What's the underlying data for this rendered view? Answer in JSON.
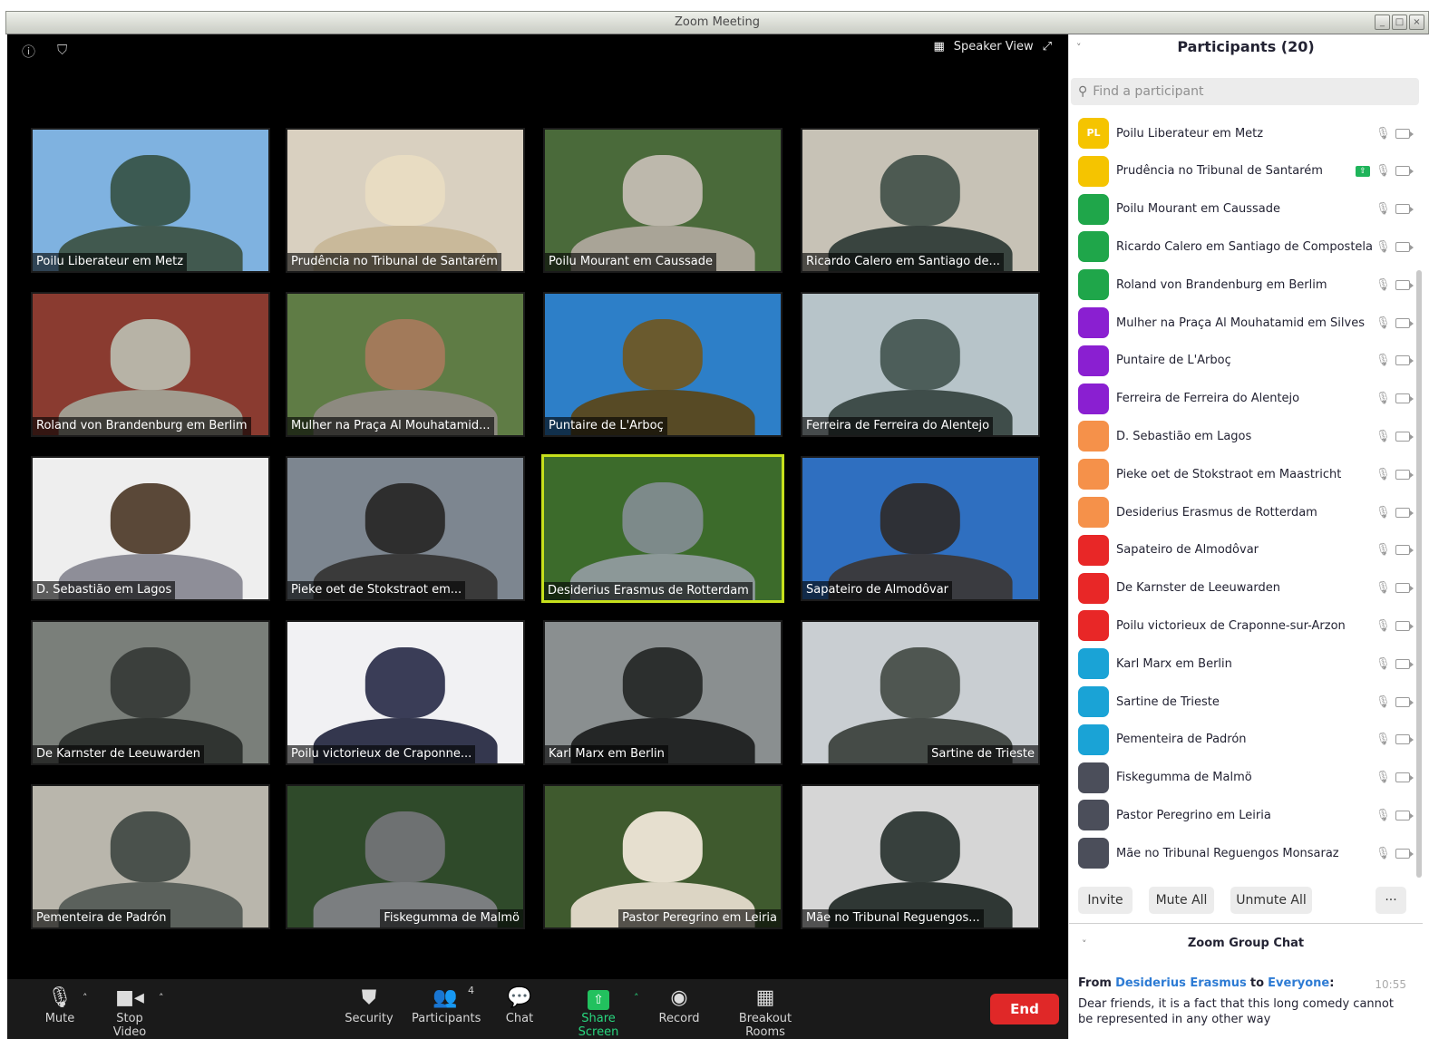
{
  "window": {
    "title": "Zoom Meeting",
    "controls": [
      "_",
      "□",
      "×"
    ]
  },
  "meeting": {
    "speaker_view_label": "Speaker View"
  },
  "tiles": [
    {
      "name": "Poilu Liberateur em Metz",
      "bg": "#7fb2e0",
      "head": "#3c5a52",
      "body": "#41594f"
    },
    {
      "name": "Prudência no Tribunal de Santarém",
      "bg": "#d9d0c0",
      "head": "#e8dcc2",
      "body": "#c9b99a"
    },
    {
      "name": "Poilu Mourant em Caussade",
      "bg": "#4a6a3a",
      "head": "#bdb8ac",
      "body": "#a9a497"
    },
    {
      "name": "Ricardo Calero em Santiago de...",
      "bg": "#c7c2b6",
      "head": "#4d5a52",
      "body": "#39443f"
    },
    {
      "name": "Roland von Brandenburg em Berlim",
      "bg": "#8a3b30",
      "head": "#b7b3a6",
      "body": "#a19d90"
    },
    {
      "name": "Mulher na Praça Al Mouhatamid...",
      "bg": "#5f7c45",
      "head": "#a27a5a",
      "body": "#8d8a80"
    },
    {
      "name": "Puntaire de L'Arboç",
      "bg": "#2d7fc8",
      "head": "#6a5a2e",
      "body": "#574a25"
    },
    {
      "name": "Ferreira de Ferreira do Alentejo",
      "bg": "#b7c4c9",
      "head": "#4d5e5a",
      "body": "#3f4d4a"
    },
    {
      "name": "D. Sebastião em Lagos",
      "bg": "#eeeeee",
      "head": "#5a4838",
      "body": "#8e8e98"
    },
    {
      "name": "Pieke oet de Stokstraot em...",
      "bg": "#7d8690",
      "head": "#2e2e2e",
      "body": "#3a3a3a"
    },
    {
      "name": "Desiderius Erasmus de Rotterdam",
      "bg": "#3c6b2b",
      "head": "#7d8a8a",
      "body": "#8c9898"
    },
    {
      "name": "Sapateiro de Almodôvar",
      "bg": "#2f6fc0",
      "head": "#2e3036",
      "body": "#3a3b40"
    },
    {
      "name": "De Karnster de Leeuwarden",
      "bg": "#7a7f7a",
      "head": "#3b3f3c",
      "body": "#303431"
    },
    {
      "name": "Poilu victorieux de Craponne...",
      "bg": "#f1f1f3",
      "head": "#3a3d57",
      "body": "#34374e"
    },
    {
      "name": "Karl Marx em Berlin",
      "bg": "#8a8f90",
      "head": "#2c2f2e",
      "body": "#242626"
    },
    {
      "name": "Sartine de Trieste",
      "bg": "#c9ced2",
      "head": "#4f5651",
      "body": "#454b47"
    },
    {
      "name": "Pementeira de Padrón",
      "bg": "#b9b6ac",
      "head": "#4a514c",
      "body": "#5b615c"
    },
    {
      "name": "Fiskegumma de Malmö",
      "bg": "#2f4a2a",
      "head": "#6e7172",
      "body": "#7b7e80"
    },
    {
      "name": "Pastor Peregrino em Leiria",
      "bg": "#3f5a2e",
      "head": "#e6dfcf",
      "body": "#dcd5c4"
    },
    {
      "name": "Mãe no Tribunal Reguengos...",
      "bg": "#d6d6d6",
      "head": "#37403d",
      "body": "#2f3734"
    }
  ],
  "toolbar": {
    "mute": "Mute",
    "stop_video": "Stop Video",
    "security": "Security",
    "participants": "Participants",
    "participants_count": "4",
    "chat": "Chat",
    "share_screen": "Share Screen",
    "record": "Record",
    "breakout_rooms": "Breakout Rooms",
    "end": "End"
  },
  "panel": {
    "title": "Participants (20)",
    "search_placeholder": "Find a participant",
    "participants": [
      {
        "name": "Poilu Liberateur em Metz",
        "initials": "PL",
        "color": "#f5c400",
        "sharing": false
      },
      {
        "name": "Prudência no Tribunal de Santarém",
        "initials": "",
        "color": "#f5c400",
        "sharing": true
      },
      {
        "name": "Poilu Mourant em Caussade",
        "initials": "",
        "color": "#1fa64a",
        "sharing": false
      },
      {
        "name": "Ricardo Calero em Santiago de Compostela",
        "initials": "",
        "color": "#1fa64a",
        "sharing": false
      },
      {
        "name": "Roland von Brandenburg em Berlim",
        "initials": "",
        "color": "#1fa64a",
        "sharing": false
      },
      {
        "name": "Mulher na Praça Al Mouhatamid em Silves",
        "initials": "",
        "color": "#8a1fd1",
        "sharing": false
      },
      {
        "name": "Puntaire de L'Arboç",
        "initials": "",
        "color": "#8a1fd1",
        "sharing": false
      },
      {
        "name": "Ferreira de Ferreira do Alentejo",
        "initials": "",
        "color": "#8a1fd1",
        "sharing": false
      },
      {
        "name": "D. Sebastião em Lagos",
        "initials": "",
        "color": "#f5914a",
        "sharing": false
      },
      {
        "name": "Pieke oet de Stokstraot em Maastricht",
        "initials": "",
        "color": "#f5914a",
        "sharing": false
      },
      {
        "name": "Desiderius Erasmus de Rotterdam",
        "initials": "",
        "color": "#f5914a",
        "sharing": false
      },
      {
        "name": "Sapateiro de Almodôvar",
        "initials": "",
        "color": "#e82727",
        "sharing": false
      },
      {
        "name": "De Karnster de Leeuwarden",
        "initials": "",
        "color": "#e82727",
        "sharing": false
      },
      {
        "name": "Poilu victorieux de Craponne-sur-Arzon",
        "initials": "",
        "color": "#e82727",
        "sharing": false
      },
      {
        "name": "Karl Marx em Berlin",
        "initials": "",
        "color": "#1aa3d6",
        "sharing": false
      },
      {
        "name": "Sartine de Trieste",
        "initials": "",
        "color": "#1aa3d6",
        "sharing": false
      },
      {
        "name": "Pementeira de Padrón",
        "initials": "",
        "color": "#1aa3d6",
        "sharing": false
      },
      {
        "name": "Fiskegumma de Malmö",
        "initials": "",
        "color": "#4b4e5a",
        "sharing": false
      },
      {
        "name": "Pastor Peregrino em Leiria",
        "initials": "",
        "color": "#4b4e5a",
        "sharing": false
      },
      {
        "name": "Mãe no Tribunal Reguengos Monsaraz",
        "initials": "",
        "color": "#4b4e5a",
        "sharing": false
      }
    ],
    "buttons": {
      "invite": "Invite",
      "mute_all": "Mute All",
      "unmute_all": "Unmute All",
      "more": "···"
    }
  },
  "chat": {
    "title": "Zoom Group Chat",
    "from_label": "From",
    "sender": "Desiderius Erasmus",
    "to_label": "to",
    "recipient": "Everyone",
    "time": "10:55",
    "message": "Dear friends, it is a fact that this long comedy cannot be represented in any other way"
  },
  "colors": {
    "accent_active_tile": "#c6e01c",
    "end_button": "#e02828",
    "share_green": "#22c15e",
    "link_blue": "#2d7bd4"
  }
}
